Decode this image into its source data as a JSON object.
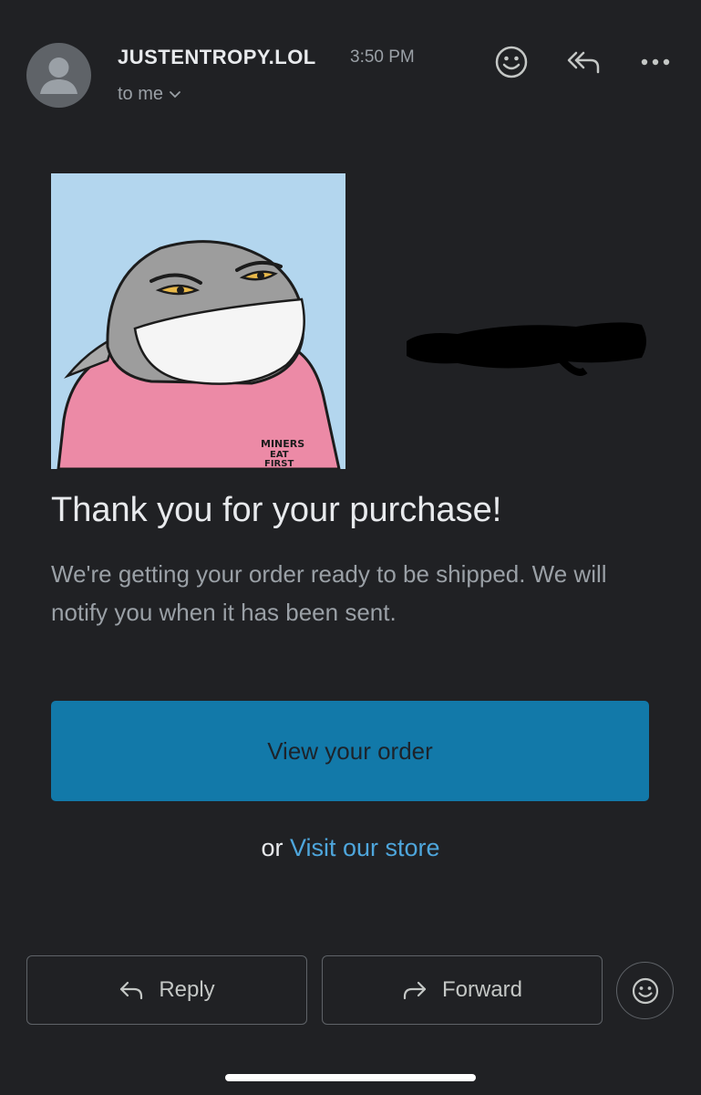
{
  "header": {
    "sender": "JUSTENTROPY.LOL",
    "time": "3:50 PM",
    "recipient": "to me",
    "icons": [
      "add-emoji-icon",
      "reply-all-icon",
      "more-options-icon"
    ]
  },
  "product_image": {
    "shirt_text_line1": "MINERS",
    "shirt_text_line2": "EAT",
    "shirt_text_line3": "FIRST"
  },
  "message": {
    "title": "Thank you for your purchase!",
    "body": "We're getting your order ready to be shipped. We will notify you when it has been sent."
  },
  "cta": {
    "label": "View your order"
  },
  "alt": {
    "prefix": "or",
    "link": "Visit our store"
  },
  "actions": {
    "reply": "Reply",
    "forward": "Forward"
  },
  "colors": {
    "background": "#202124",
    "accent_button": "#1279a9",
    "link": "#4ea6dc"
  }
}
